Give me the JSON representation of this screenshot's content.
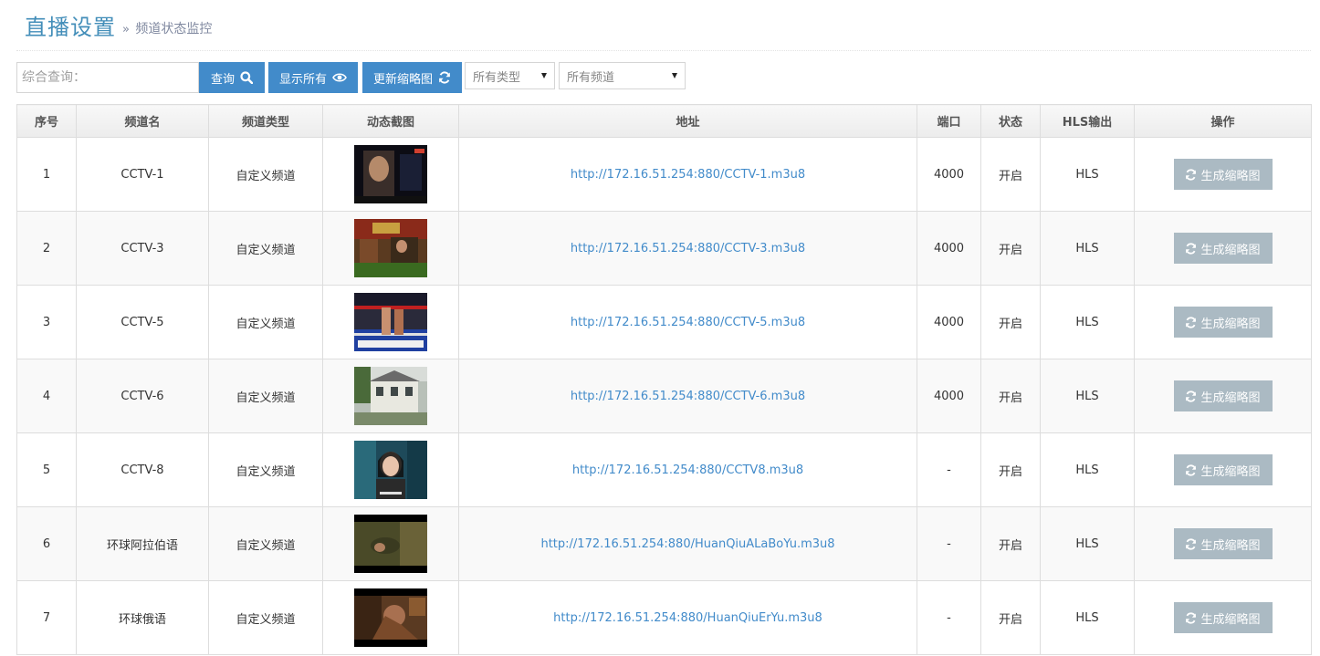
{
  "header": {
    "title": "直播设置",
    "subtitle_separator": "»",
    "subtitle": "频道状态监控"
  },
  "toolbar": {
    "search_placeholder": "综合查询：",
    "query_label": "查询",
    "show_all_label": "显示所有",
    "refresh_thumbs_label": "更新缩略图",
    "type_select_value": "所有类型",
    "channel_select_value": "所有频道"
  },
  "table": {
    "columns": [
      "序号",
      "频道名",
      "频道类型",
      "动态截图",
      "地址",
      "端口",
      "状态",
      "HLS输出",
      "操作"
    ],
    "action_label": "生成缩略图",
    "rows": [
      {
        "no": "1",
        "name": "CCTV-1",
        "type": "自定义频道",
        "url": "http://172.16.51.254:880/CCTV-1.m3u8",
        "port": "4000",
        "status": "开启",
        "hls": "HLS"
      },
      {
        "no": "2",
        "name": "CCTV-3",
        "type": "自定义频道",
        "url": "http://172.16.51.254:880/CCTV-3.m3u8",
        "port": "4000",
        "status": "开启",
        "hls": "HLS"
      },
      {
        "no": "3",
        "name": "CCTV-5",
        "type": "自定义频道",
        "url": "http://172.16.51.254:880/CCTV-5.m3u8",
        "port": "4000",
        "status": "开启",
        "hls": "HLS"
      },
      {
        "no": "4",
        "name": "CCTV-6",
        "type": "自定义频道",
        "url": "http://172.16.51.254:880/CCTV-6.m3u8",
        "port": "4000",
        "status": "开启",
        "hls": "HLS"
      },
      {
        "no": "5",
        "name": "CCTV-8",
        "type": "自定义频道",
        "url": "http://172.16.51.254:880/CCTV8.m3u8",
        "port": "-",
        "status": "开启",
        "hls": "HLS"
      },
      {
        "no": "6",
        "name": "环球阿拉伯语",
        "type": "自定义频道",
        "url": "http://172.16.51.254:880/HuanQiuALaBoYu.m3u8",
        "port": "-",
        "status": "开启",
        "hls": "HLS"
      },
      {
        "no": "7",
        "name": "环球俄语",
        "type": "自定义频道",
        "url": "http://172.16.51.254:880/HuanQiuErYu.m3u8",
        "port": "-",
        "status": "开启",
        "hls": "HLS"
      }
    ]
  },
  "colors": {
    "title": "#438eb9",
    "primary_button": "#428bca",
    "disabled_button": "#abbac3",
    "link": "#428bca"
  },
  "icons": {
    "query": "search-icon",
    "show_all": "eye-icon",
    "refresh": "refresh-icon"
  }
}
